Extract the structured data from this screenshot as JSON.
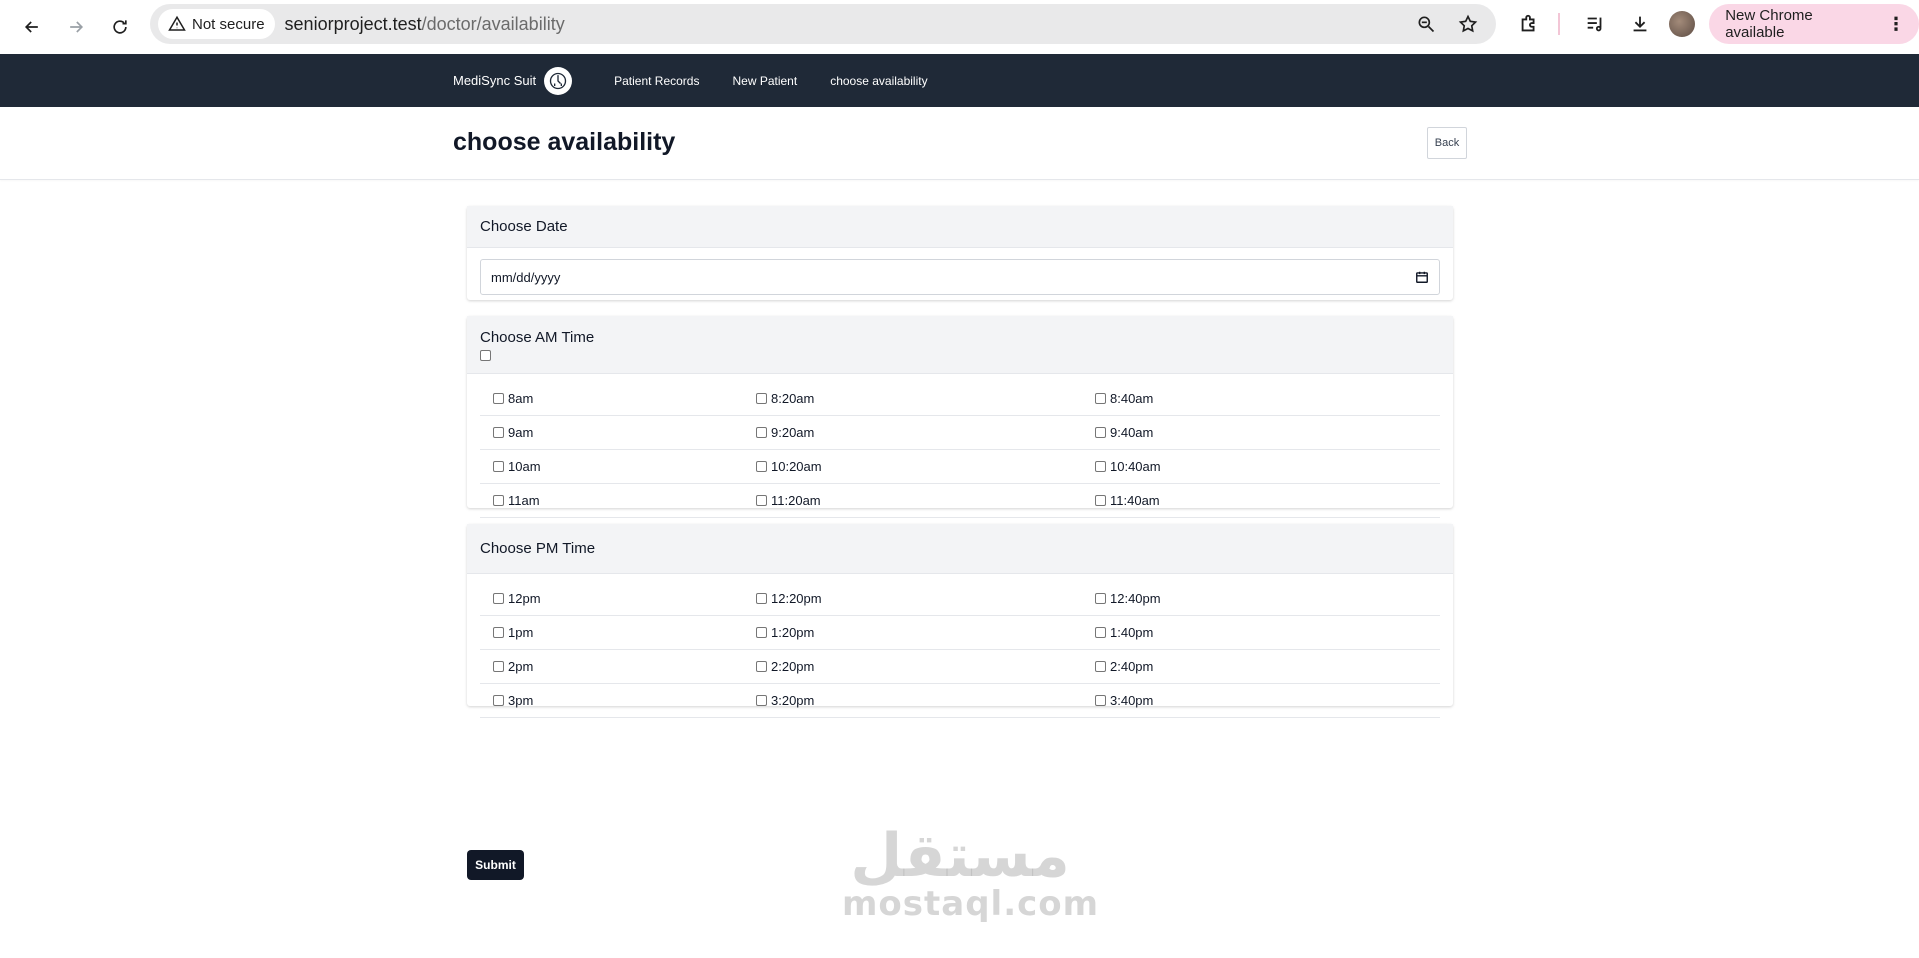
{
  "browser": {
    "security_label": "Not secure",
    "url_host": "seniorproject.test",
    "url_path": "/doctor/availability",
    "update_label": "New Chrome available"
  },
  "app": {
    "brand": "MediSync Suit",
    "nav": [
      "Patient Records",
      "New Patient",
      "choose availability"
    ]
  },
  "page": {
    "title": "choose availability",
    "back_label": "Back"
  },
  "date_card": {
    "title": "Choose Date",
    "placeholder": "mm/dd/yyyy"
  },
  "am_card": {
    "title": "Choose AM Time",
    "rows": [
      [
        "8am",
        "8:20am",
        "8:40am"
      ],
      [
        "9am",
        "9:20am",
        "9:40am"
      ],
      [
        "10am",
        "10:20am",
        "10:40am"
      ],
      [
        "11am",
        "11:20am",
        "11:40am"
      ]
    ]
  },
  "pm_card": {
    "title": "Choose PM Time",
    "rows": [
      [
        "12pm",
        "12:20pm",
        "12:40pm"
      ],
      [
        "1pm",
        "1:20pm",
        "1:40pm"
      ],
      [
        "2pm",
        "2:20pm",
        "2:40pm"
      ],
      [
        "3pm",
        "3:20pm",
        "3:40pm"
      ]
    ]
  },
  "submit_label": "Submit",
  "watermark": {
    "arabic": "مستقل",
    "latin": "mostaql.com"
  }
}
